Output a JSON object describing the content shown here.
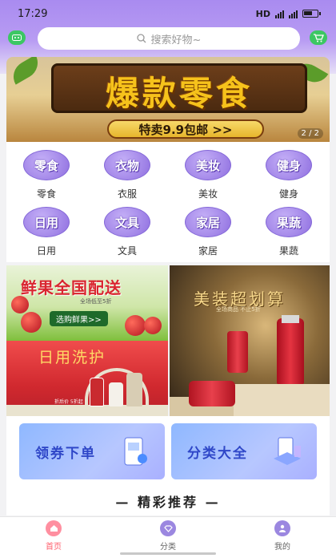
{
  "statusbar": {
    "time": "17:29",
    "network": "HD"
  },
  "search": {
    "placeholder": "搜索好物~"
  },
  "banner": {
    "title": "爆款零食",
    "subtitle": "特卖9.9包邮 >>",
    "pager": "2 / 2"
  },
  "categories": [
    {
      "icon_text": "零食",
      "label": "零食"
    },
    {
      "icon_text": "衣物",
      "label": "衣服"
    },
    {
      "icon_text": "美妆",
      "label": "美妆"
    },
    {
      "icon_text": "健身",
      "label": "健身"
    },
    {
      "icon_text": "日用",
      "label": "日用"
    },
    {
      "icon_text": "文具",
      "label": "文具"
    },
    {
      "icon_text": "家居",
      "label": "家居"
    },
    {
      "icon_text": "果蔬",
      "label": "果蔬"
    }
  ],
  "promos": {
    "fruit": {
      "title": "鲜果全国配送",
      "meta": "全场低至5折",
      "button": "选购鲜果>>"
    },
    "daily": {
      "title": "日用洗护",
      "tag": "折后价 5折起"
    },
    "beauty": {
      "title": "美装超划算",
      "meta": "全场商品 不止5折"
    }
  },
  "coupons": [
    {
      "label": "领券下单"
    },
    {
      "label": "分类大全"
    }
  ],
  "recommend": {
    "title": "— 精彩推荐 —"
  },
  "tabs": [
    {
      "label": "首页",
      "color": "#ff5f6d",
      "icon_bg": "#ff8fa0"
    },
    {
      "label": "分类",
      "color": "#666666",
      "icon_bg": "#9b87e0"
    },
    {
      "label": "我的",
      "color": "#666666",
      "icon_bg": "#9b87e0"
    }
  ]
}
